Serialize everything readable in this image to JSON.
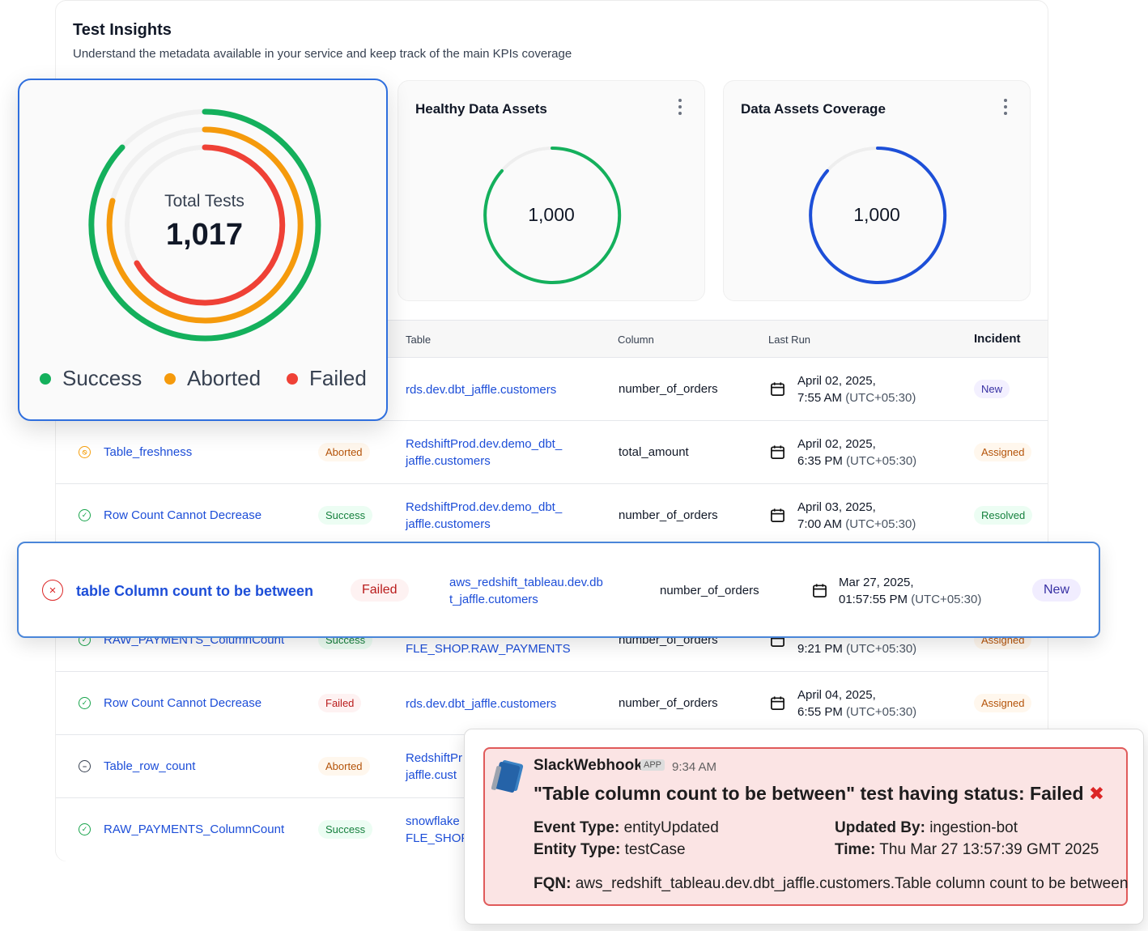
{
  "header": {
    "title": "Test Insights",
    "subtitle": "Understand the metadata available in your service and keep track of the main KPIs coverage"
  },
  "total_tests": {
    "title": "Total Tests",
    "value": "1,017",
    "legend": [
      {
        "label": "Success",
        "color": "#14b05c"
      },
      {
        "label": "Aborted",
        "color": "#f59a0c"
      },
      {
        "label": "Failed",
        "color": "#ef4136"
      }
    ]
  },
  "healthy_card": {
    "title": "Healthy Data Assets",
    "value": "1,000",
    "color": "#14b05c"
  },
  "coverage_card": {
    "title": "Data Assets Coverage",
    "value": "1,000",
    "color": "#1d4fd8"
  },
  "table": {
    "columns": {
      "table": "Table",
      "column": "Column",
      "last_run": "Last Run",
      "incident": "Incident"
    },
    "rows": [
      {
        "table": "rds.dev.dbt_jaffle.customers",
        "column": "number_of_orders",
        "date": "April 02, 2025,",
        "time": "7:55 AM",
        "tz": "(UTC+05:30)",
        "incident": "New"
      },
      {
        "name": "Table_freshness",
        "status": "Aborted",
        "table1": "RedshiftProd.dev.demo_dbt_",
        "table2": "jaffle.customers",
        "column": "total_amount",
        "date": "April 02, 2025,",
        "time": "6:35 PM",
        "tz": "(UTC+05:30)",
        "incident": "Assigned"
      },
      {
        "name": "Row Count Cannot Decrease",
        "status": "Success",
        "table1": "RedshiftProd.dev.demo_dbt_",
        "table2": "jaffle.customers",
        "column": "number_of_orders",
        "date": "April 03, 2025,",
        "time": "7:00 AM",
        "tz": "(UTC+05:30)",
        "incident": "Resolved"
      },
      {
        "name": "RAW_PAYMENTS_ColumnCount",
        "status": "Success",
        "table2": "FLE_SHOP.RAW_PAYMENTS",
        "column": "number_of_orders",
        "time": "9:21 PM",
        "tz": "(UTC+05:30)",
        "incident": "Assigned"
      },
      {
        "name": "Row Count Cannot Decrease",
        "status": "Failed",
        "table": "rds.dev.dbt_jaffle.customers",
        "column": "number_of_orders",
        "date": "April 04, 2025,",
        "time": "6:55 PM",
        "tz": "(UTC+05:30)",
        "incident": "Assigned"
      },
      {
        "name": "Table_row_count",
        "status": "Aborted",
        "table1": "RedshiftPr",
        "table2": "jaffle.cust"
      },
      {
        "name": "RAW_PAYMENTS_ColumnCount",
        "status": "Success",
        "table1": "snowflake",
        "table2": "FLE_SHOP"
      }
    ]
  },
  "highlight": {
    "name": "table Column count to be between",
    "status": "Failed",
    "table1": "aws_redshift_tableau.dev.db",
    "table2": "t_jaffle.cutomers",
    "column": "number_of_orders",
    "date": "Mar 27, 2025,",
    "time": "01:57:55 PM",
    "tz": "(UTC+05:30)",
    "incident": "New"
  },
  "slack": {
    "sender": "SlackWebhook",
    "app_tag": "APP",
    "time": "9:34 AM",
    "headline": "\"Table column count to be between\" test having status: Failed",
    "event_type_label": "Event Type:",
    "event_type": "entityUpdated",
    "entity_type_label": "Entity Type:",
    "entity_type": "testCase",
    "updated_by_label": "Updated By:",
    "updated_by": "ingestion-bot",
    "time_label": "Time:",
    "time_value": "Thu Mar 27 13:57:39 GMT 2025",
    "fqn_label": "FQN:",
    "fqn": "aws_redshift_tableau.dev.dbt_jaffle.customers.Table column count to be between"
  }
}
